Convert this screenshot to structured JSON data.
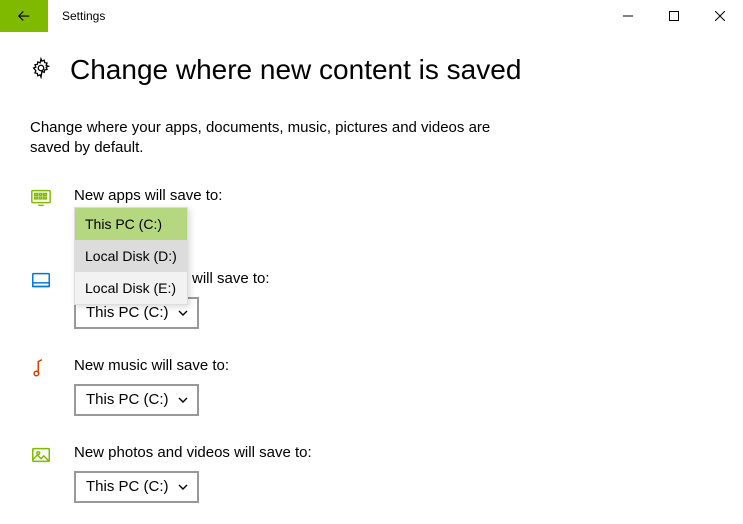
{
  "window": {
    "title": "Settings"
  },
  "page": {
    "title": "Change where new content is saved",
    "description": "Change where your apps, documents, music, pictures and videos are saved by default."
  },
  "sections": {
    "apps": {
      "label": "New apps will save to:",
      "value": "This PC (C:)",
      "options": [
        "This PC (C:)",
        "Local Disk (D:)",
        "Local Disk (E:)"
      ]
    },
    "documents": {
      "label": "will save to:",
      "value": "This PC (C:)"
    },
    "music": {
      "label": "New music will save to:",
      "value": "This PC (C:)"
    },
    "photos": {
      "label": "New photos and videos will save to:",
      "value": "This PC (C:)"
    }
  }
}
